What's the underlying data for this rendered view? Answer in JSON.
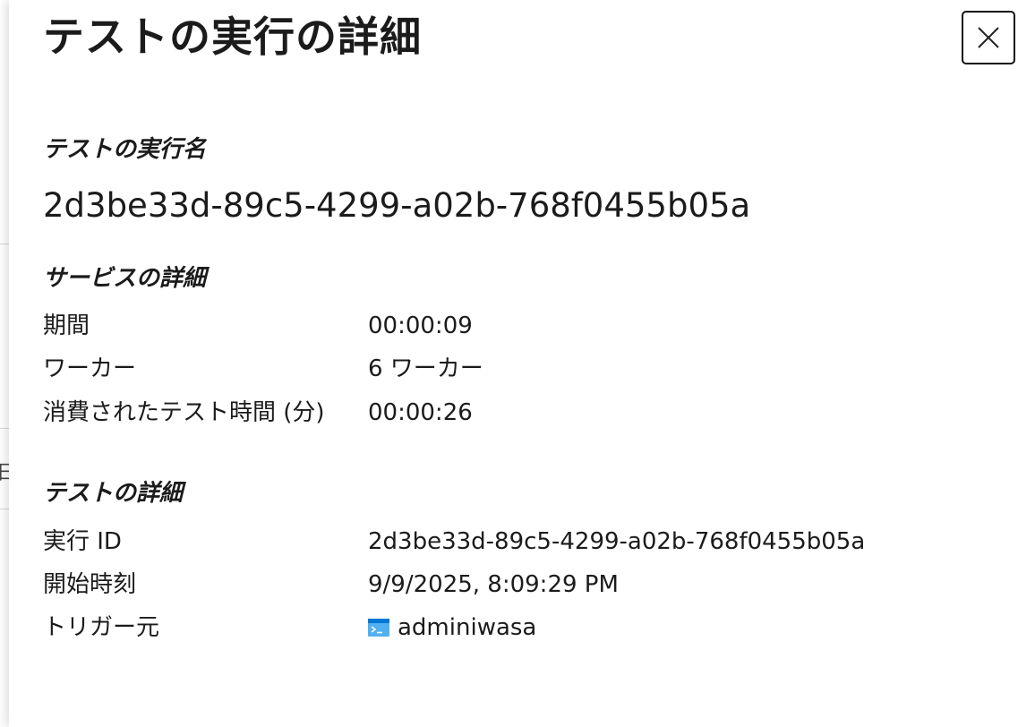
{
  "backdrop": {
    "fragment": "日"
  },
  "panel": {
    "title": "テストの実行の詳細",
    "close_icon": "close-icon"
  },
  "run_name_section": {
    "heading": "テストの実行名",
    "value": "2d3be33d-89c5-4299-a02b-768f0455b05a"
  },
  "service_details": {
    "heading": "サービスの詳細",
    "rows": [
      {
        "label": "期間",
        "value": "00:00:09"
      },
      {
        "label": "ワーカー",
        "value": "6 ワーカー"
      },
      {
        "label": "消費されたテスト時間 (分)",
        "value": "00:00:26"
      }
    ]
  },
  "test_details": {
    "heading": "テストの詳細",
    "rows": [
      {
        "label": "実行 ID",
        "value": "2d3be33d-89c5-4299-a02b-768f0455b05a"
      },
      {
        "label": "開始時刻",
        "value": "9/9/2025, 8:09:29 PM"
      },
      {
        "label": "トリガー元",
        "value": "adminiwasa",
        "icon": "terminal-icon"
      }
    ]
  },
  "colors": {
    "text": "#1b1b1b",
    "icon_blue": "#0078d4",
    "icon_light_blue": "#50b0f0"
  }
}
